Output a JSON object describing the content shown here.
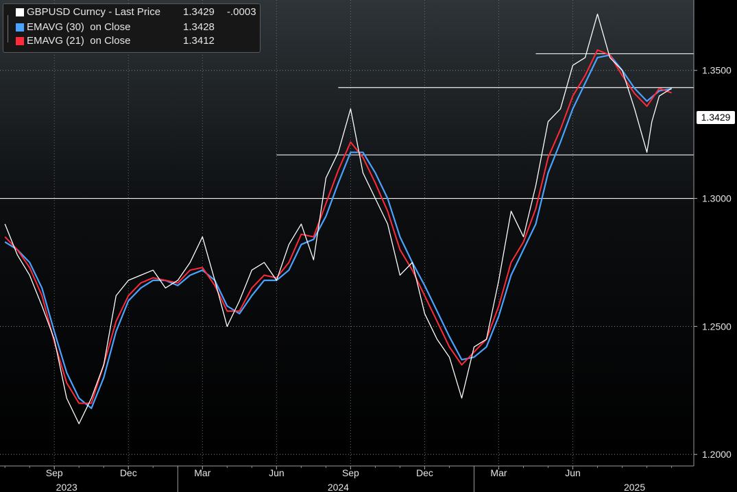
{
  "chart_data": {
    "type": "line",
    "legend": [
      {
        "label": "GBPUSD Curncy - Last Price",
        "value": "1.3429",
        "change": "-.0003",
        "color": "#ffffff"
      },
      {
        "label": "EMAVG (30)  on Close",
        "value": "1.3428",
        "color": "#4aa3ff"
      },
      {
        "label": "EMAVG (21)  on Close",
        "value": "1.3412",
        "color": "#ff2a3a"
      }
    ],
    "last_price_label": "1.3429",
    "y_ticks": [
      "1.3500",
      "1.3000",
      "1.2500",
      "1.2000"
    ],
    "y_tick_values": [
      1.35,
      1.3,
      1.25,
      1.2
    ],
    "ylim": [
      1.1955,
      1.3775
    ],
    "x_ticks": [
      "Sep",
      "Dec",
      "Mar",
      "Jun",
      "Sep",
      "Dec",
      "Mar",
      "Jun"
    ],
    "x_tick_months": [
      2,
      5,
      8,
      11,
      14,
      17,
      20,
      23
    ],
    "years": [
      {
        "label": "2023",
        "month": 2.5
      },
      {
        "label": "2024",
        "month": 13.5
      },
      {
        "label": "2025",
        "month": 25.5
      }
    ],
    "year_separators": [
      7,
      19
    ],
    "xlim": [
      -0.2,
      27.9
    ],
    "horizontal_levels": [
      {
        "value": 1.3,
        "from_month": -0.2
      },
      {
        "value": 1.317,
        "from_month": 11.0
      },
      {
        "value": 1.3433,
        "from_month": 13.5
      },
      {
        "value": 1.3565,
        "from_month": 21.5
      }
    ],
    "series": [
      {
        "name": "GBPUSD Curncy - Last Price",
        "color": "#ffffff",
        "x": [
          0,
          0.5,
          1,
          1.5,
          2,
          2.5,
          3,
          3.5,
          4,
          4.5,
          5,
          5.5,
          6,
          6.5,
          7,
          7.5,
          8,
          8.5,
          9,
          9.5,
          10,
          10.5,
          11,
          11.5,
          12,
          12.5,
          13,
          13.5,
          14,
          14.5,
          15,
          15.5,
          16,
          16.5,
          17,
          17.5,
          18,
          18.5,
          19,
          19.5,
          20,
          20.5,
          21,
          21.5,
          22,
          22.5,
          23,
          23.5,
          24,
          24.5,
          25,
          25.5,
          26,
          26.2,
          26.5,
          27
        ],
        "values": [
          1.29,
          1.278,
          1.27,
          1.258,
          1.245,
          1.222,
          1.212,
          1.222,
          1.235,
          1.262,
          1.268,
          1.27,
          1.272,
          1.265,
          1.268,
          1.275,
          1.285,
          1.268,
          1.25,
          1.26,
          1.272,
          1.275,
          1.268,
          1.282,
          1.29,
          1.276,
          1.308,
          1.318,
          1.335,
          1.31,
          1.3,
          1.29,
          1.27,
          1.275,
          1.255,
          1.245,
          1.238,
          1.222,
          1.242,
          1.245,
          1.268,
          1.295,
          1.285,
          1.305,
          1.33,
          1.335,
          1.352,
          1.355,
          1.372,
          1.355,
          1.35,
          1.335,
          1.318,
          1.33,
          1.34,
          1.343
        ]
      },
      {
        "name": "EMAVG (30)  on Close",
        "color": "#4aa3ff",
        "x": [
          0,
          0.5,
          1,
          1.5,
          2,
          2.5,
          3,
          3.5,
          4,
          4.5,
          5,
          5.5,
          6,
          6.5,
          7,
          7.5,
          8,
          8.5,
          9,
          9.5,
          10,
          10.5,
          11,
          11.5,
          12,
          12.5,
          13,
          13.5,
          14,
          14.5,
          15,
          15.5,
          16,
          16.5,
          17,
          17.5,
          18,
          18.5,
          19,
          19.5,
          20,
          20.5,
          21,
          21.5,
          22,
          22.5,
          23,
          23.5,
          24,
          24.5,
          25,
          25.5,
          26,
          26.5,
          27
        ],
        "values": [
          1.283,
          1.28,
          1.275,
          1.265,
          1.248,
          1.232,
          1.222,
          1.218,
          1.23,
          1.248,
          1.26,
          1.265,
          1.268,
          1.268,
          1.266,
          1.27,
          1.272,
          1.268,
          1.258,
          1.255,
          1.262,
          1.268,
          1.268,
          1.272,
          1.282,
          1.284,
          1.293,
          1.306,
          1.318,
          1.318,
          1.31,
          1.3,
          1.285,
          1.275,
          1.266,
          1.256,
          1.246,
          1.237,
          1.238,
          1.242,
          1.254,
          1.27,
          1.28,
          1.29,
          1.31,
          1.322,
          1.335,
          1.345,
          1.355,
          1.356,
          1.35,
          1.343,
          1.338,
          1.342,
          1.3428
        ]
      },
      {
        "name": "EMAVG (21)  on Close",
        "color": "#ff2a3a",
        "x": [
          0,
          0.5,
          1,
          1.5,
          2,
          2.5,
          3,
          3.5,
          4,
          4.5,
          5,
          5.5,
          6,
          6.5,
          7,
          7.5,
          8,
          8.5,
          9,
          9.5,
          10,
          10.5,
          11,
          11.5,
          12,
          12.5,
          13,
          13.5,
          14,
          14.5,
          15,
          15.5,
          16,
          16.5,
          17,
          17.5,
          18,
          18.5,
          19,
          19.5,
          20,
          20.5,
          21,
          21.5,
          22,
          22.5,
          23,
          23.5,
          24,
          24.5,
          25,
          25.5,
          26,
          26.5,
          27
        ],
        "values": [
          1.285,
          1.28,
          1.273,
          1.262,
          1.244,
          1.228,
          1.22,
          1.22,
          1.235,
          1.252,
          1.262,
          1.267,
          1.269,
          1.268,
          1.267,
          1.272,
          1.273,
          1.266,
          1.256,
          1.256,
          1.265,
          1.27,
          1.269,
          1.275,
          1.286,
          1.285,
          1.298,
          1.311,
          1.322,
          1.316,
          1.306,
          1.295,
          1.28,
          1.272,
          1.262,
          1.252,
          1.242,
          1.235,
          1.24,
          1.245,
          1.258,
          1.275,
          1.283,
          1.296,
          1.316,
          1.327,
          1.34,
          1.348,
          1.358,
          1.356,
          1.348,
          1.341,
          1.336,
          1.343,
          1.3412
        ]
      }
    ]
  }
}
